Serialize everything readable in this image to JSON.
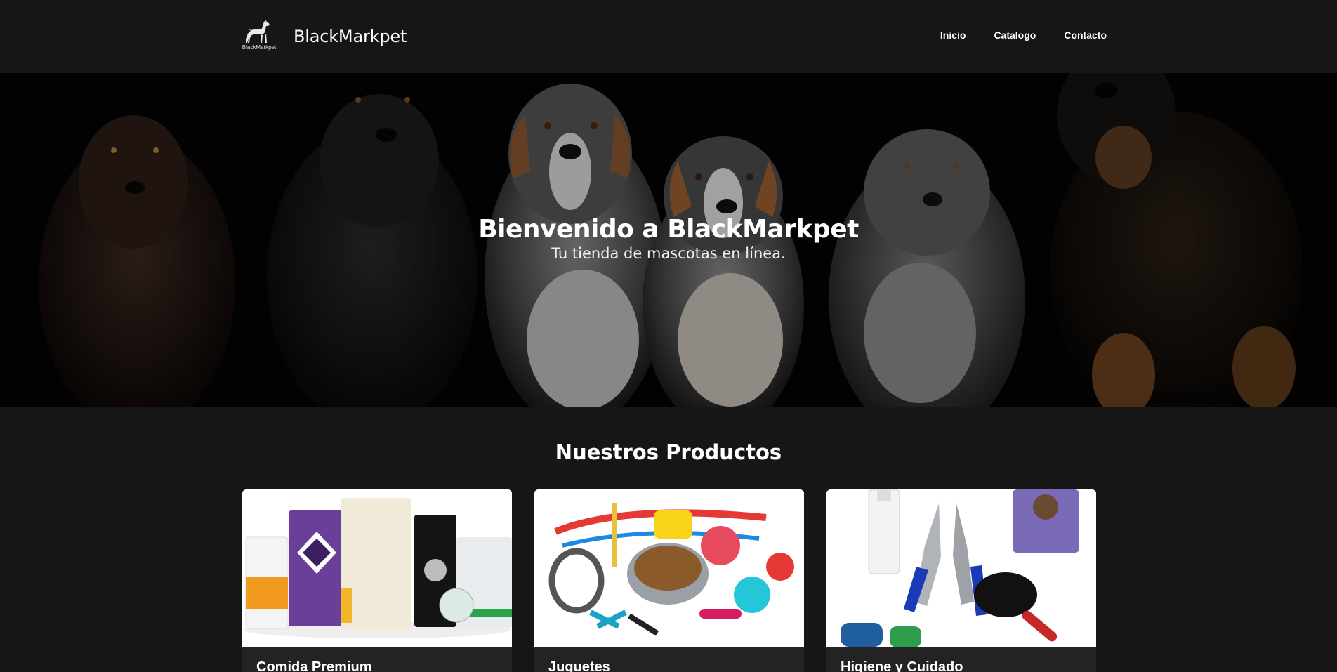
{
  "navbar": {
    "logo_text": "BlackMarkpet",
    "brand_name": "BlackMarkpet",
    "links": [
      {
        "label": "Inicio"
      },
      {
        "label": "Catalogo"
      },
      {
        "label": "Contacto"
      }
    ]
  },
  "hero": {
    "title": "Bienvenido a BlackMarkpet",
    "subtitle": "Tu tienda de mascotas en línea."
  },
  "products": {
    "title": "Nuestros Productos",
    "items": [
      {
        "title": "Comida Premium",
        "image": "pet-food-bags-image"
      },
      {
        "title": "Juguetes",
        "image": "pet-toys-image"
      },
      {
        "title": "Higiene y Cuidado",
        "image": "grooming-tools-image"
      }
    ]
  },
  "colors": {
    "background": "#161616",
    "card_body": "#232323",
    "text": "#ffffff"
  }
}
